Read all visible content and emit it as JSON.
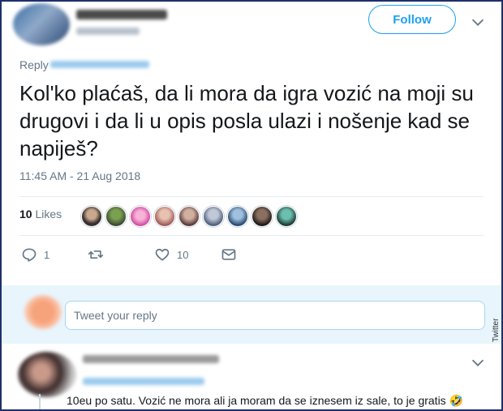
{
  "header": {
    "follow_label": "Follow"
  },
  "tweet": {
    "reply_prefix": "Reply",
    "text": "Kol'ko plaćaš, da li mora da igra vozić na moji su drugovi i da li u opis posla ulazi i nošenje kad se napiješ?",
    "timestamp": "11:45 AM - 21 Aug 2018",
    "likes_count": "10",
    "likes_label": "Likes"
  },
  "actions": {
    "reply_count": "1",
    "retweet_count": "",
    "like_count": "10"
  },
  "compose": {
    "placeholder": "Tweet your reply"
  },
  "reply": {
    "text": "10eu po satu. Vozić ne mora ali ja moram da se iznesem iz sale, to je gratis 🤣"
  },
  "watermark": "Twitter",
  "colors": {
    "accent": "#1da1f2",
    "reply_bg": "#e8f5fd",
    "frame": "#1f2f6b"
  }
}
